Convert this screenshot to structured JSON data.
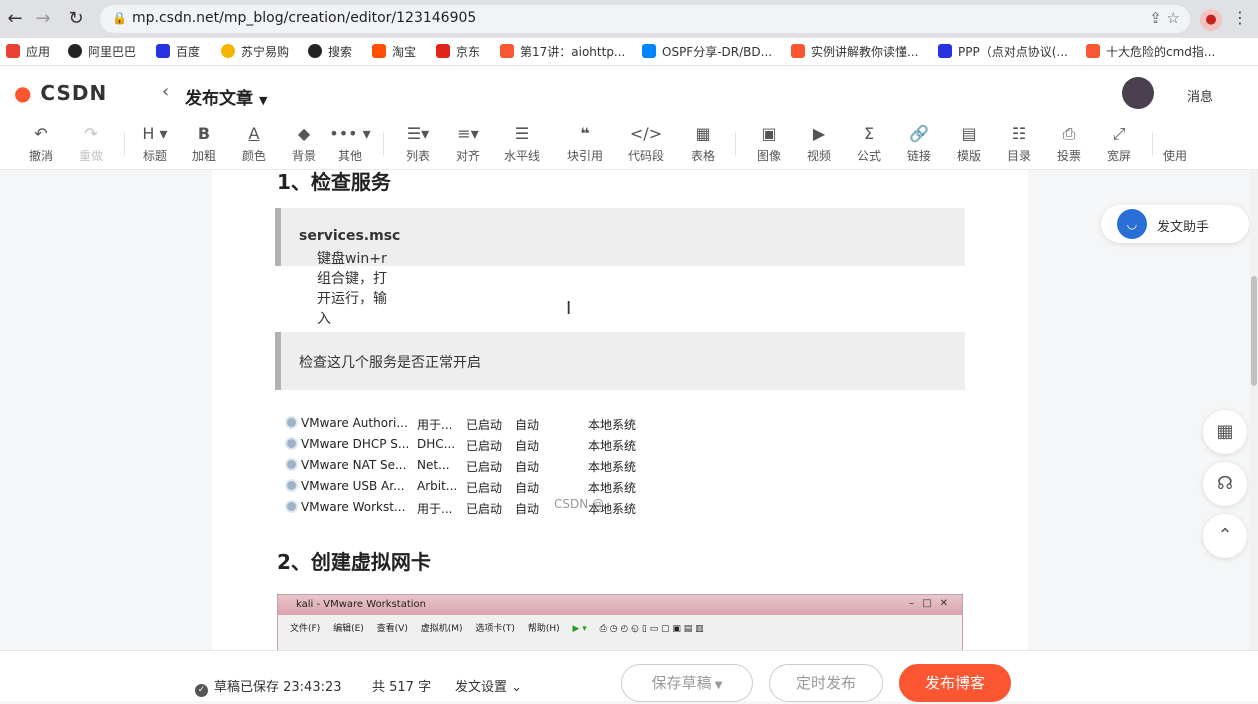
{
  "browser": {
    "url": "mp.csdn.net/mp_blog/creation/editor/123146905",
    "bookmarks": [
      "应用",
      "阿里巴巴",
      "百度",
      "苏宁易购",
      "搜索",
      "淘宝",
      "京东",
      "第17讲：aiohttp...",
      "OSPF分享-DR/BD...",
      "实例讲解教你读懂...",
      "PPP（点对点协议(...",
      "十大危险的cmd指..."
    ]
  },
  "header": {
    "logo": "CSDN",
    "title": "发布文章",
    "messages": "消息"
  },
  "toolbar": [
    "撤消",
    "重做",
    "标题",
    "加粗",
    "颜色",
    "背景",
    "其他",
    "列表",
    "对齐",
    "水平线",
    "块引用",
    "代码段",
    "表格",
    "图像",
    "视频",
    "公式",
    "链接",
    "模版",
    "目录",
    "投票",
    "宽屏",
    "使用"
  ],
  "editor": {
    "heading1": "1、检查服务",
    "quote1_prefix": "键盘win+r组合键，打开运行，输入",
    "quote1_bold": "services.msc",
    "quote2": "检查这几个服务是否正常开启",
    "services": [
      {
        "name": "VMware Authori...",
        "desc": "用于...",
        "status": "已启动",
        "start": "自动",
        "logon": "本地系统"
      },
      {
        "name": "VMware DHCP S...",
        "desc": "DHC...",
        "status": "已启动",
        "start": "自动",
        "logon": "本地系统"
      },
      {
        "name": "VMware NAT Se...",
        "desc": "Net...",
        "status": "已启动",
        "start": "自动",
        "logon": "本地系统"
      },
      {
        "name": "VMware USB Ar...",
        "desc": "Arbit...",
        "status": "已启动",
        "start": "自动",
        "logon": "本地系统"
      },
      {
        "name": "VMware Workst...",
        "desc": "用于...",
        "status": "已启动",
        "start": "自动",
        "logon": "本地系统"
      }
    ],
    "watermark": "CSDN @",
    "heading2": "2、创建虚拟网卡",
    "vm_title": "kali - VMware Workstation",
    "vm_menu": [
      "文件(F)",
      "编辑(E)",
      "查看(V)",
      "虚拟机(M)",
      "选项卡(T)",
      "帮助(H)"
    ]
  },
  "assistant": {
    "label": "发文助手"
  },
  "footer": {
    "saved": "草稿已保存 23:43:23",
    "count": "共 517 字",
    "settings": "发文设置",
    "draft": "保存草稿",
    "timed": "定时发布",
    "publish": "发布博客"
  }
}
